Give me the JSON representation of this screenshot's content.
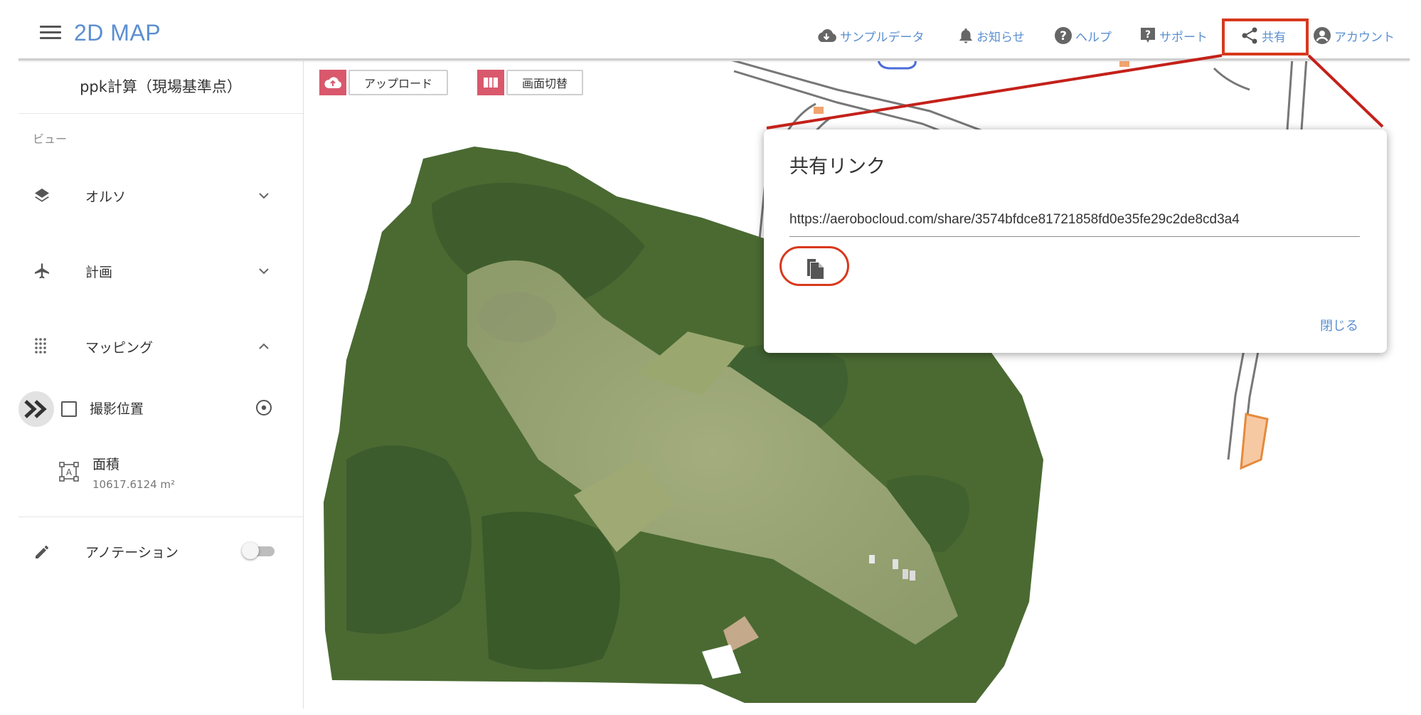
{
  "header": {
    "app_title": "2D MAP",
    "nav": [
      {
        "label": "サンプルデータ",
        "icon": "cloud-download-icon"
      },
      {
        "label": "お知らせ",
        "icon": "bell-icon"
      },
      {
        "label": "ヘルプ",
        "icon": "help-circle-icon"
      },
      {
        "label": "サポート",
        "icon": "support-icon"
      },
      {
        "label": "共有",
        "icon": "share-icon"
      },
      {
        "label": "アカウント",
        "icon": "account-circle-icon"
      }
    ]
  },
  "sidebar": {
    "project_title": "ppk計算（現場基準点）",
    "view_label": "ビュー",
    "items": [
      {
        "label": "オルソ",
        "icon": "layers-icon",
        "expanded": false
      },
      {
        "label": "計画",
        "icon": "airplane-icon",
        "expanded": false
      },
      {
        "label": "マッピング",
        "icon": "grid-dots-icon",
        "expanded": true
      }
    ],
    "photo_positions": {
      "label": "撮影位置",
      "checked": false
    },
    "area": {
      "label": "面積",
      "value": "10617.6124 m²"
    },
    "annotation": {
      "label": "アノテーション",
      "enabled": false
    }
  },
  "map_toolbar": {
    "upload_label": "アップロード",
    "switch_label": "画面切替"
  },
  "share_dialog": {
    "title": "共有リンク",
    "url": "https://aerobocloud.com/share/3574bfdce81721858fd0e35fe29c2de8cd3a4",
    "close_label": "閉じる"
  },
  "colors": {
    "accent_blue": "#5b8fd0",
    "callout_red": "#d8391d",
    "tool_pink": "#d9586c"
  }
}
